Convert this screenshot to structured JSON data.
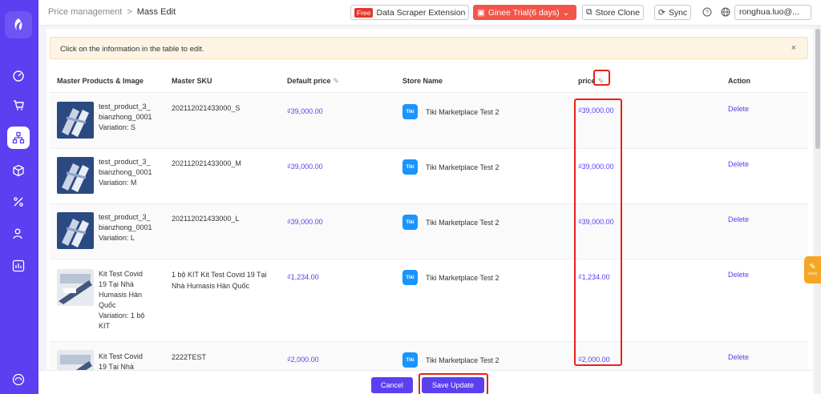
{
  "breadcrumb": {
    "parent": "Price management",
    "separator": ">",
    "current": "Mass Edit"
  },
  "header": {
    "free_tag": "Free",
    "scraper_label": "Data Scraper Extension",
    "trial_label": "Ginee Trial(6 days)",
    "store_clone_label": "Store Clone",
    "sync_label": "Sync",
    "user_label": "ronghua.luo@..."
  },
  "notice": {
    "text": "Click on the information in the table to edit.",
    "close": "×"
  },
  "table": {
    "headers": {
      "product": "Master Products & Image",
      "sku": "Master SKU",
      "default_price": "Default price",
      "store": "Store Name",
      "price": "price",
      "action": "Action"
    },
    "rows": [
      {
        "name_lines": [
          "test_product_3_",
          "bianzhong_0001",
          "Variation: S"
        ],
        "sku_lines": [
          "202112021433000_S"
        ],
        "default_price": "₫39,000.00",
        "store_icon": "Tiki",
        "store": "Tiki Marketplace Test 2",
        "price": "₫39,000.00",
        "action": "Delete"
      },
      {
        "name_lines": [
          "test_product_3_",
          "bianzhong_0001",
          "Variation: M"
        ],
        "sku_lines": [
          "202112021433000_M"
        ],
        "default_price": "₫39,000.00",
        "store_icon": "Tiki",
        "store": "Tiki Marketplace Test 2",
        "price": "₫39,000.00",
        "action": "Delete"
      },
      {
        "name_lines": [
          "test_product_3_",
          "bianzhong_0001",
          "Variation: L"
        ],
        "sku_lines": [
          "202112021433000_L"
        ],
        "default_price": "₫39,000.00",
        "store_icon": "Tiki",
        "store": "Tiki Marketplace Test 2",
        "price": "₫39,000.00",
        "action": "Delete"
      },
      {
        "name_lines": [
          "Kit Test Covid",
          "19 Tại Nhà",
          "Humasis Hàn",
          "Quốc",
          "Variation: 1 bộ",
          "KIT"
        ],
        "sku_lines": [
          "1 bộ KIT Kit Test Covid 19 Tại",
          "Nhà Humasis Hàn Quốc"
        ],
        "default_price": "₫1,234.00",
        "store_icon": "Tiki",
        "store": "Tiki Marketplace Test 2",
        "price": "₫1,234.00",
        "action": "Delete"
      },
      {
        "name_lines": [
          "Kit Test Covid",
          "19 Tại Nhà"
        ],
        "sku_lines": [
          "2222TEST"
        ],
        "default_price": "₫2,000.00",
        "store_icon": "Tiki",
        "store": "Tiki Marketplace Test 2",
        "price": "₫2,000.00",
        "action": "Delete"
      }
    ]
  },
  "footer": {
    "cancel_label": "Cancel",
    "save_label": "Save Update"
  },
  "side_tool_label": "<<<",
  "colors": {
    "primary": "#5b3ff0",
    "sidebar": "#5b3ff0",
    "trial": "#f2554a",
    "highlight": "#e8221a",
    "notice_bg": "#fef4e4"
  }
}
